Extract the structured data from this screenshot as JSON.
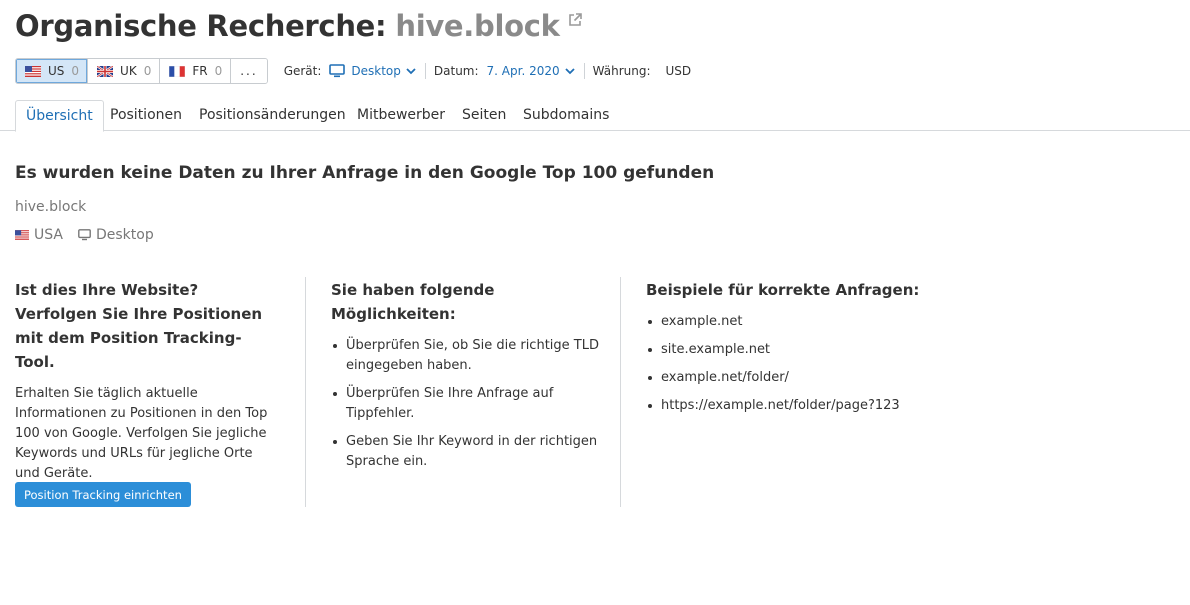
{
  "header": {
    "title": "Organische Recherche:",
    "domain": "hive.block"
  },
  "databases": [
    {
      "code": "US",
      "count": "0",
      "active": true
    },
    {
      "code": "UK",
      "count": "0",
      "active": false
    },
    {
      "code": "FR",
      "count": "0",
      "active": false
    }
  ],
  "more_label": "...",
  "filters": {
    "device_label": "Gerät:",
    "device_value": "Desktop",
    "date_label": "Datum:",
    "date_value": "7. Apr. 2020",
    "currency_label": "Währung:",
    "currency_value": "USD"
  },
  "tabs": [
    {
      "label": "Übersicht",
      "active": true
    },
    {
      "label": "Positionen"
    },
    {
      "label": "Positionsänderungen"
    },
    {
      "label": "Mitbewerber"
    },
    {
      "label": "Seiten"
    },
    {
      "label": "Subdomains"
    }
  ],
  "result": {
    "heading": "Es wurden keine Daten zu Ihrer Anfrage in den Google Top 100 gefunden",
    "domain": "hive.block",
    "country": "USA",
    "device": "Desktop"
  },
  "column1": {
    "title": "Ist dies Ihre Website? Verfolgen Sie Ihre Positionen mit dem Position Tracking-Tool.",
    "description": "Erhalten Sie täglich aktuelle Informationen zu Positionen in den Top 100 von Google. Verfolgen Sie jegliche Keywords und URLs für jegliche Orte und Geräte.",
    "button": "Position Tracking einrichten"
  },
  "column2": {
    "title": "Sie haben folgende Möglichkeiten:",
    "items": [
      "Überprüfen Sie, ob Sie die richtige TLD eingegeben haben.",
      "Überprüfen Sie Ihre Anfrage auf Tippfehler.",
      "Geben Sie Ihr Keyword in der richtigen Sprache ein."
    ]
  },
  "column3": {
    "title": "Beispiele für korrekte Anfragen:",
    "items": [
      "example.net",
      "site.example.net",
      "example.net/folder/",
      "https://example.net/folder/page?123"
    ]
  },
  "colors": {
    "accent": "#1f6fb5",
    "button": "#2c8ed8",
    "active_db_bg": "#d4e6f7"
  }
}
